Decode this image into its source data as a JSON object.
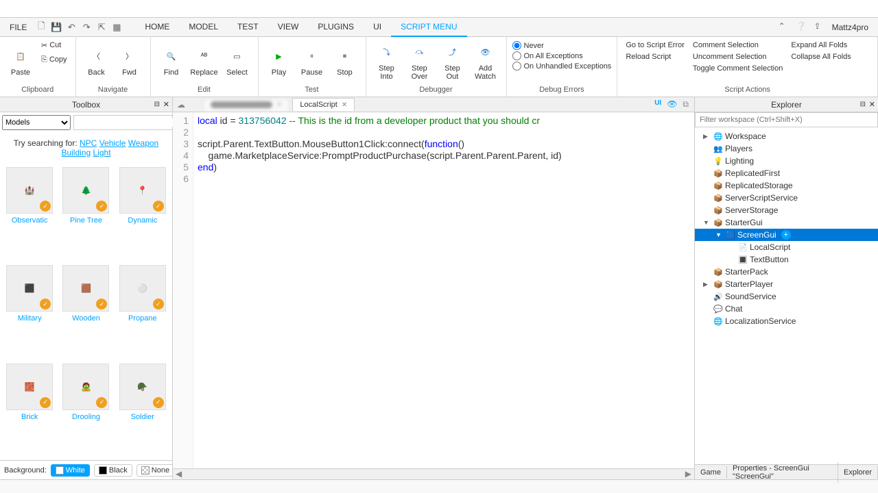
{
  "menubar": {
    "file": "FILE",
    "tabs": [
      "HOME",
      "MODEL",
      "TEST",
      "VIEW",
      "PLUGINS",
      "UI",
      "SCRIPT MENU"
    ],
    "active_tab": 6,
    "username": "Mattz4pro"
  },
  "ribbon": {
    "clipboard": {
      "label": "Clipboard",
      "paste": "Paste",
      "cut": "Cut",
      "copy": "Copy"
    },
    "navigate": {
      "label": "Navigate",
      "back": "Back",
      "fwd": "Fwd"
    },
    "edit": {
      "label": "Edit",
      "find": "Find",
      "replace": "Replace",
      "select": "Select"
    },
    "test": {
      "label": "Test",
      "play": "Play",
      "pause": "Pause",
      "stop": "Stop"
    },
    "debugger": {
      "label": "Debugger",
      "step_into": "Step\nInto",
      "step_over": "Step\nOver",
      "step_out": "Step\nOut",
      "add_watch": "Add\nWatch"
    },
    "debug_errors": {
      "label": "Debug Errors",
      "never": "Never",
      "on_all": "On All Exceptions",
      "on_unhandled": "On Unhandled Exceptions"
    },
    "script_actions": {
      "label": "Script Actions",
      "go_error": "Go to Script Error",
      "reload": "Reload Script",
      "comment": "Comment Selection",
      "uncomment": "Uncomment Selection",
      "toggle": "Toggle Comment Selection",
      "expand": "Expand All Folds",
      "collapse": "Collapse All Folds"
    }
  },
  "toolbox": {
    "title": "Toolbox",
    "category": "Models",
    "search_placeholder": "",
    "suggest_prefix": "Try searching for: ",
    "suggest_links": [
      "NPC",
      "Vehicle",
      "Weapon",
      "Building",
      "Light"
    ],
    "assets": [
      "Observatic",
      "Pine Tree",
      "Dynamic",
      "Military",
      "Wooden",
      "Propane",
      "Brick",
      "Drooling",
      "Soldier"
    ],
    "bg_label": "Background:",
    "bg_options": [
      "White",
      "Black",
      "None"
    ]
  },
  "editor": {
    "tab1": "",
    "tab2": "LocalScript",
    "ui_badge": "UI",
    "code_lines": [
      {
        "n": 1,
        "t": "local id = 313756042 -- This is the id from a developer product that you should cr"
      },
      {
        "n": 2,
        "t": ""
      },
      {
        "n": 3,
        "t": "script.Parent.TextButton.MouseButton1Click:connect(function()"
      },
      {
        "n": 4,
        "t": "    game.MarketplaceService:PromptProductPurchase(script.Parent.Parent.Parent, id)"
      },
      {
        "n": 5,
        "t": "end)"
      },
      {
        "n": 6,
        "t": ""
      }
    ]
  },
  "explorer": {
    "title": "Explorer",
    "filter_placeholder": "Filter workspace (Ctrl+Shift+X)",
    "tree": [
      {
        "name": "Workspace",
        "indent": 0,
        "icon": "🌐",
        "arrow": "▶"
      },
      {
        "name": "Players",
        "indent": 0,
        "icon": "👥",
        "arrow": ""
      },
      {
        "name": "Lighting",
        "indent": 0,
        "icon": "💡",
        "arrow": ""
      },
      {
        "name": "ReplicatedFirst",
        "indent": 0,
        "icon": "📦",
        "arrow": ""
      },
      {
        "name": "ReplicatedStorage",
        "indent": 0,
        "icon": "📦",
        "arrow": ""
      },
      {
        "name": "ServerScriptService",
        "indent": 0,
        "icon": "📦",
        "arrow": ""
      },
      {
        "name": "ServerStorage",
        "indent": 0,
        "icon": "📦",
        "arrow": ""
      },
      {
        "name": "StarterGui",
        "indent": 0,
        "icon": "📦",
        "arrow": "▼"
      },
      {
        "name": "ScreenGui",
        "indent": 1,
        "icon": "🟦",
        "arrow": "▼",
        "sel": true,
        "plus": true
      },
      {
        "name": "LocalScript",
        "indent": 2,
        "icon": "📄",
        "arrow": ""
      },
      {
        "name": "TextButton",
        "indent": 2,
        "icon": "🔳",
        "arrow": ""
      },
      {
        "name": "StarterPack",
        "indent": 0,
        "icon": "📦",
        "arrow": ""
      },
      {
        "name": "StarterPlayer",
        "indent": 0,
        "icon": "📦",
        "arrow": "▶"
      },
      {
        "name": "SoundService",
        "indent": 0,
        "icon": "🔊",
        "arrow": ""
      },
      {
        "name": "Chat",
        "indent": 0,
        "icon": "💬",
        "arrow": ""
      },
      {
        "name": "LocalizationService",
        "indent": 0,
        "icon": "🌐",
        "arrow": ""
      }
    ]
  },
  "bottom_tabs": [
    "Game",
    "Properties - ScreenGui \"ScreenGui\"",
    "Explorer"
  ]
}
